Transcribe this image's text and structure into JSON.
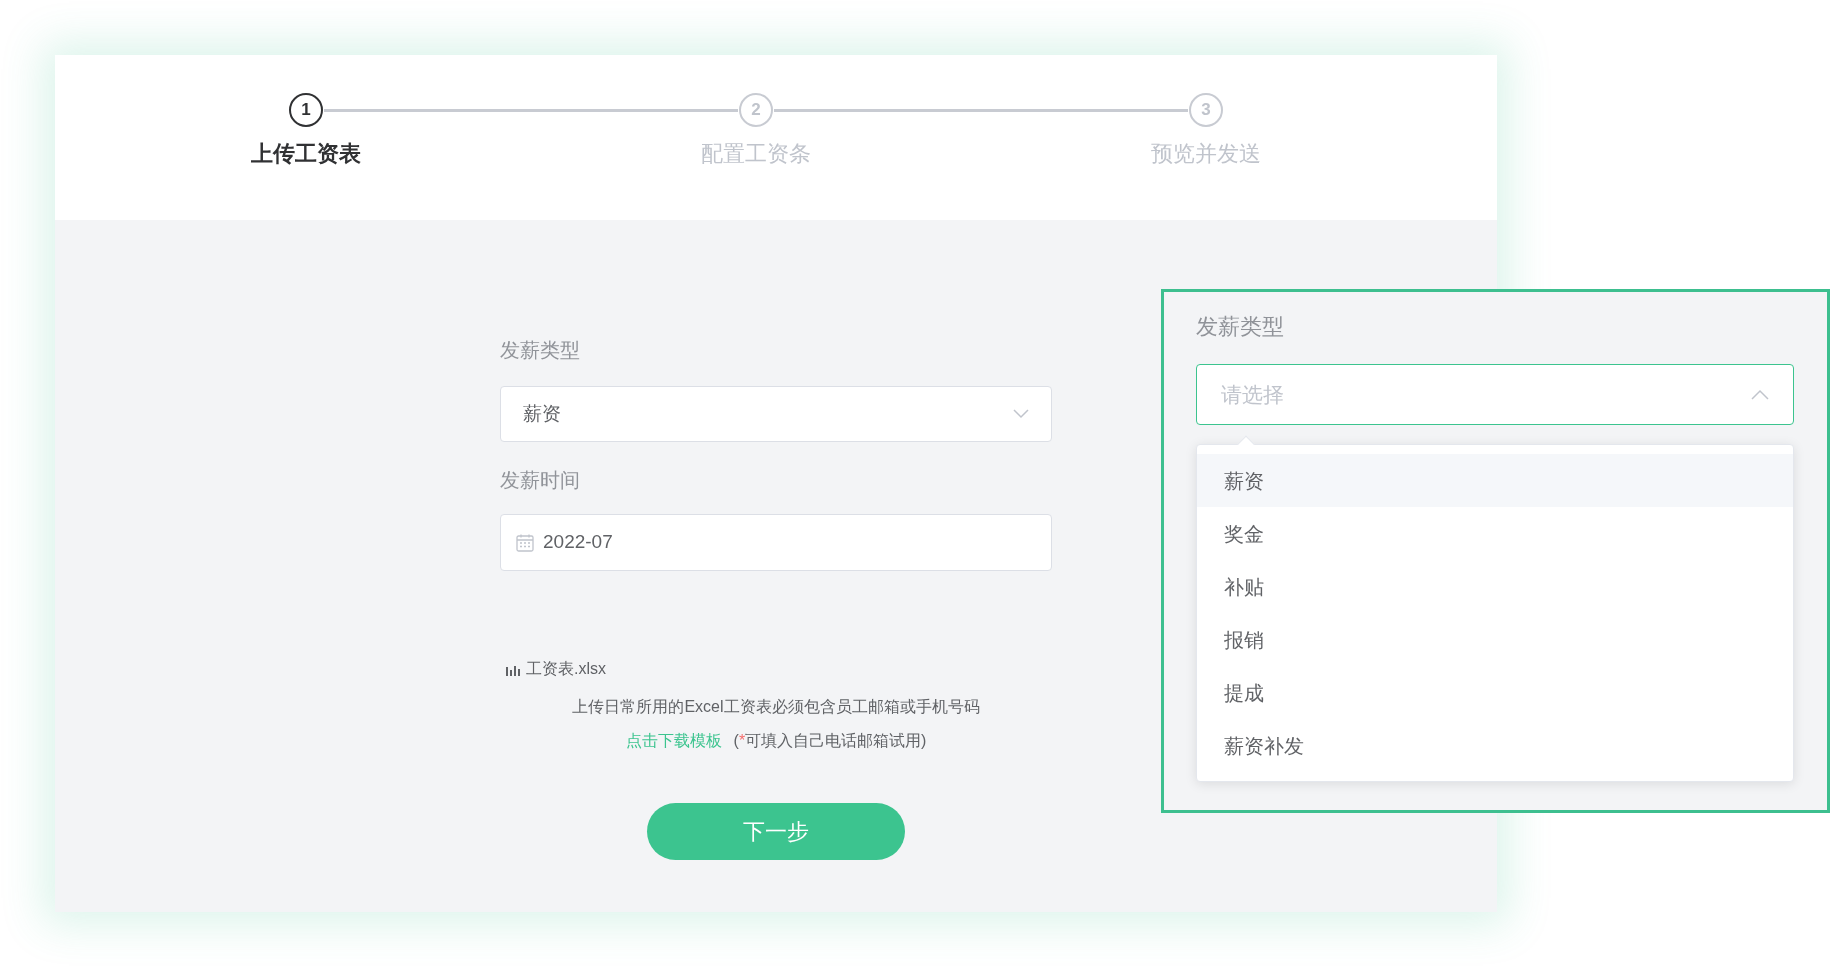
{
  "steps": [
    {
      "number": "1",
      "label": "上传工资表",
      "active": true
    },
    {
      "number": "2",
      "label": "配置工资条",
      "active": false
    },
    {
      "number": "3",
      "label": "预览并发送",
      "active": false
    }
  ],
  "form": {
    "type_field": {
      "label": "发薪类型",
      "value": "薪资"
    },
    "date_field": {
      "label": "发薪时间",
      "value": "2022-07"
    }
  },
  "file": {
    "name": "工资表.xlsx"
  },
  "hint": "上传日常所用的Excel工资表必须包含员工邮箱或手机号码",
  "template_link": "点击下载模板",
  "note": {
    "open": "(",
    "mark": "*",
    "text": "可填入自己电话邮箱试用)"
  },
  "next_button": "下一步",
  "callout": {
    "label": "发薪类型",
    "placeholder": "请选择",
    "expanded": true,
    "options": [
      {
        "label": "薪资",
        "hovered": true
      },
      {
        "label": "奖金",
        "hovered": false
      },
      {
        "label": "补贴",
        "hovered": false
      },
      {
        "label": "报销",
        "hovered": false
      },
      {
        "label": "提成",
        "hovered": false
      },
      {
        "label": "薪资补发",
        "hovered": false
      }
    ]
  }
}
